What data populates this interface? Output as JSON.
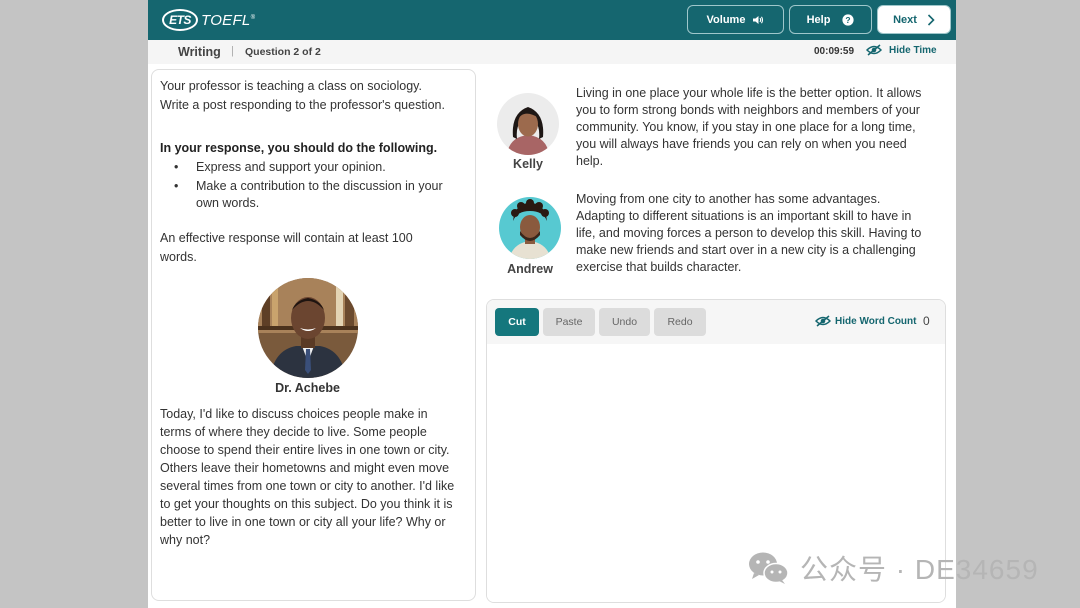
{
  "header": {
    "logo_ets": "ETS",
    "logo_toefl": "TOEFL",
    "volume_label": "Volume",
    "help_label": "Help",
    "next_label": "Next"
  },
  "subheader": {
    "section": "Writing",
    "separator": "|",
    "question": "Question 2 of 2",
    "timer": "00:09:59",
    "hide_time": "Hide Time"
  },
  "left_panel": {
    "prompt": "Your professor is teaching a class on sociology. Write a post responding to the professor's question.",
    "instructions_heading": "In your response, you should do the following.",
    "bullets": [
      "Express and support your opinion.",
      "Make a contribution to the discussion in your own words."
    ],
    "effective_note": "An effective response will contain at least 100 words.",
    "professor_name": "Dr. Achebe",
    "professor_text": "Today, I'd like to discuss choices people make in terms of where they decide to live. Some people choose to spend their entire lives in one town or city. Others leave their hometowns and might even move several times from one town or city to another. I'd like to get your thoughts on this subject. Do you think it is better to live in one town or city all your life? Why or why not?"
  },
  "students": [
    {
      "name": "Kelly",
      "text": "Living in one place your whole life is the better option. It allows you to form strong bonds with neighbors and members of your community. You know, if you stay in one place for a long time, you will always have friends you can rely on when you need help."
    },
    {
      "name": "Andrew",
      "text": "Moving from one city to another has some advantages. Adapting to different situations is an important skill to have in life, and moving forces a person to develop this skill. Having to make new friends and start over in a new city is a challenging exercise that builds character."
    }
  ],
  "editor": {
    "cut": "Cut",
    "paste": "Paste",
    "undo": "Undo",
    "redo": "Redo",
    "hide_word_count": "Hide Word Count",
    "word_count": "0",
    "content": ""
  },
  "watermark": "公众号 · DE34659",
  "colors": {
    "brand_teal": "#15666f",
    "button_teal": "#15777d"
  }
}
